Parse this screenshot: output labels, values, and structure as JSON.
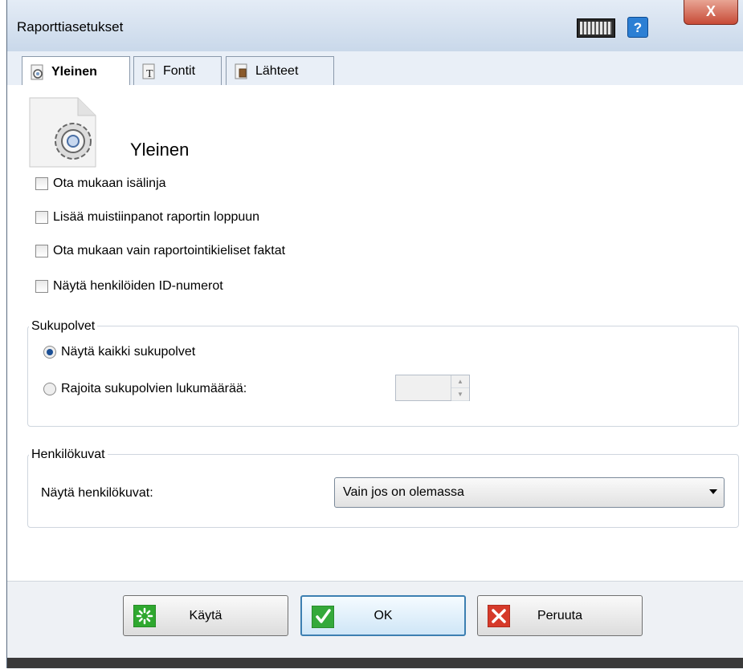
{
  "window": {
    "title": "Raporttiasetukset",
    "help_label": "?",
    "close_label": "X"
  },
  "tabs": [
    {
      "label": "Yleinen",
      "active": true,
      "icon": "gear-document-icon"
    },
    {
      "label": "Fontit",
      "active": false,
      "icon": "font-icon"
    },
    {
      "label": "Lähteet",
      "active": false,
      "icon": "sources-icon"
    }
  ],
  "page": {
    "heading": "Yleinen"
  },
  "options": [
    {
      "label": "Ota mukaan isälinja",
      "checked": false
    },
    {
      "label": "Lisää muistiinpanot raportin loppuun",
      "checked": false
    },
    {
      "label": "Ota mukaan vain raportointikieliset faktat",
      "checked": false
    },
    {
      "label": "Näytä henkilöiden ID-numerot",
      "checked": false
    }
  ],
  "generations": {
    "title": "Sukupolvet",
    "radio_all": "Näytä kaikki sukupolvet",
    "radio_limit": "Rajoita sukupolvien lukumäärää:",
    "selected": "all",
    "limit_value": ""
  },
  "photos": {
    "title": "Henkilökuvat",
    "label": "Näytä henkilökuvat:",
    "selected": "Vain jos on olemassa"
  },
  "buttons": {
    "apply": "Käytä",
    "ok": "OK",
    "cancel": "Peruuta"
  },
  "colors": {
    "apply_icon": "#2fa82f",
    "ok_icon": "#34a93b",
    "cancel_icon": "#d63a2a",
    "accent": "#3c7fb1"
  }
}
